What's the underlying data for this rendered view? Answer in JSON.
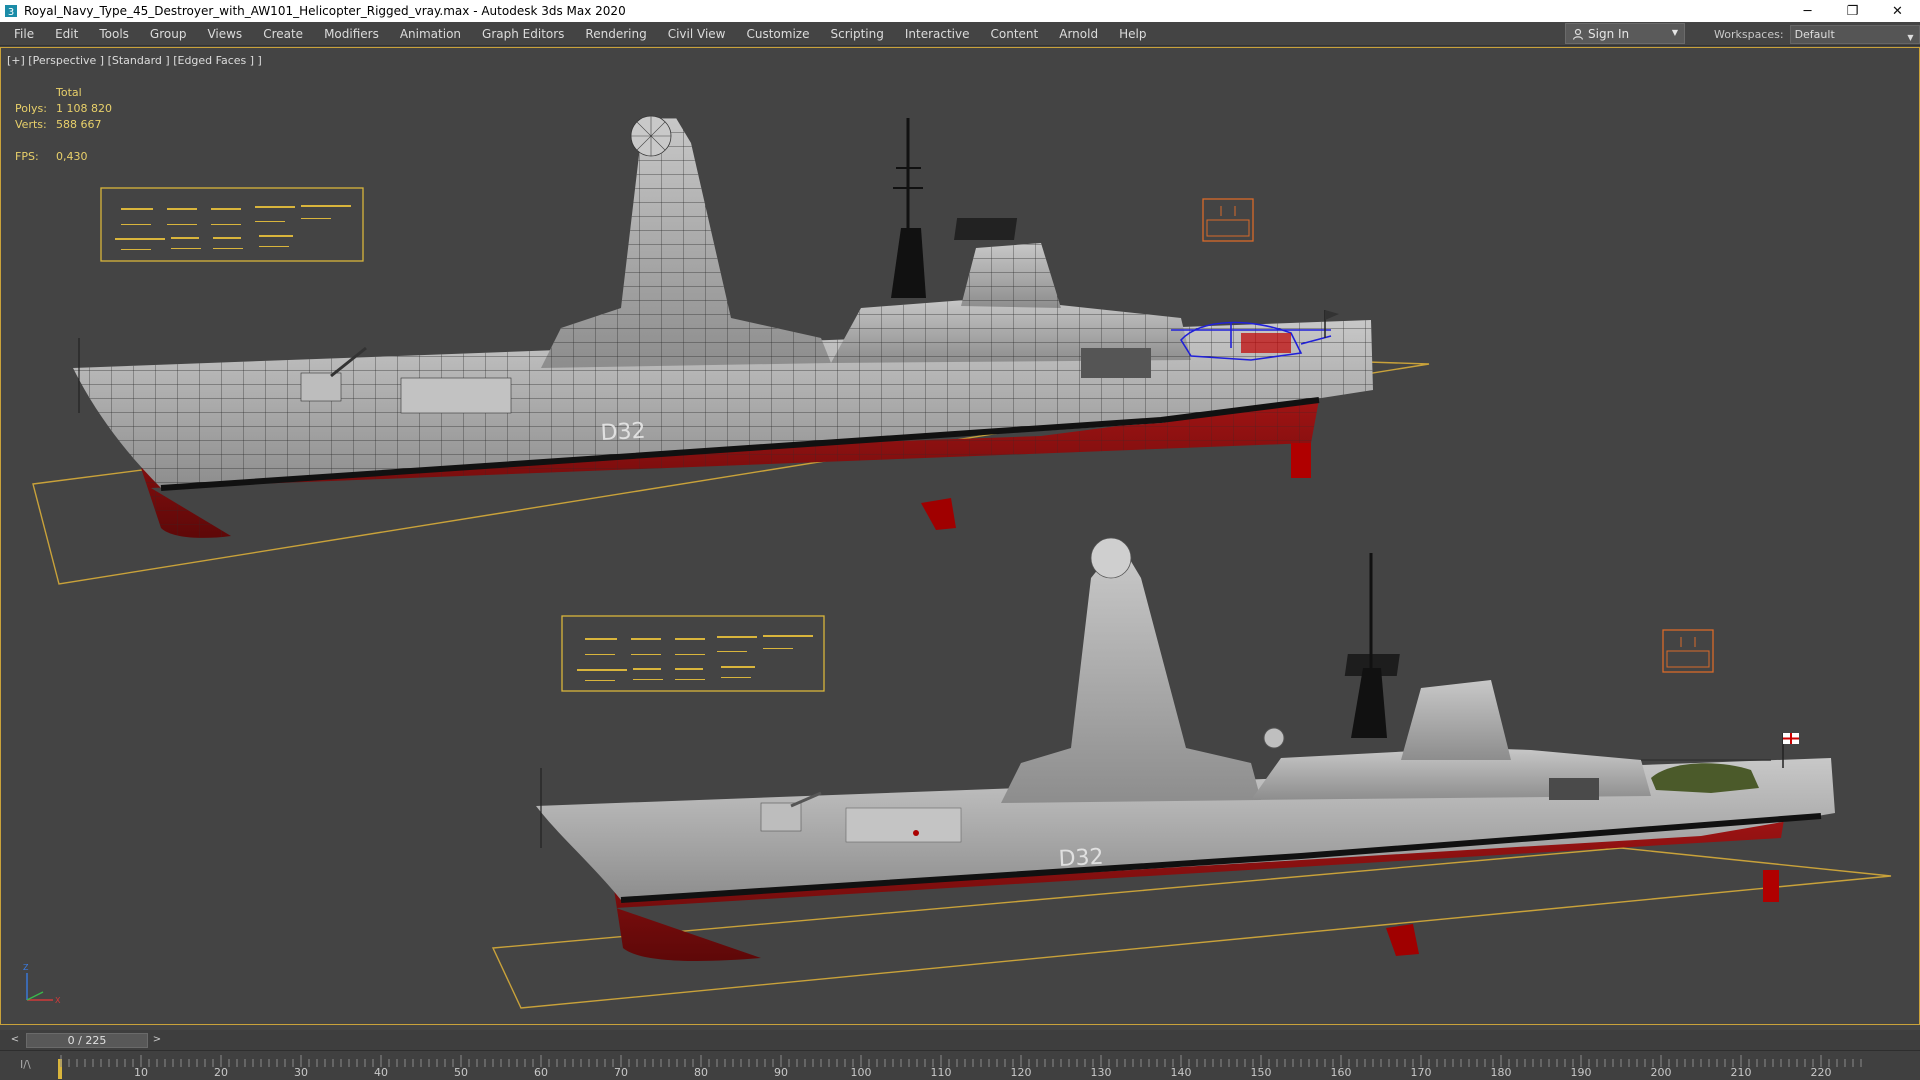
{
  "window": {
    "title": "Royal_Navy_Type_45_Destroyer_with_AW101_Helicopter_Rigged_vray.max - Autodesk 3ds Max 2020",
    "app_icon": "3ds-max-icon",
    "minimize": "─",
    "restore": "❐",
    "close": "✕"
  },
  "menu": {
    "items": [
      "File",
      "Edit",
      "Tools",
      "Group",
      "Views",
      "Create",
      "Modifiers",
      "Animation",
      "Graph Editors",
      "Rendering",
      "Civil View",
      "Customize",
      "Scripting",
      "Interactive",
      "Content",
      "Arnold",
      "Help"
    ],
    "sign_in": "Sign In",
    "workspaces_label": "Workspaces:",
    "workspaces_value": "Default"
  },
  "viewport": {
    "label": "[+] [Perspective ] [Standard ] [Edged Faces ]   ]",
    "stats": {
      "total_label": "Total",
      "polys_label": "Polys:",
      "polys_value": "1 108 820",
      "verts_label": "Verts:",
      "verts_value": "588 667",
      "fps_label": "FPS:",
      "fps_value": "0,430"
    },
    "hull_number_top": "D32",
    "hull_number_bottom": "D32",
    "axis_labels": [
      "Z",
      "X"
    ],
    "colors": {
      "selection": "#d9b53c",
      "hull_red": "#8a1010",
      "hull_grey": "#a8a8a8",
      "wire_helicopter": "#2020d8"
    }
  },
  "timeline": {
    "frame_display": "0 / 225",
    "prev": "<",
    "next": ">",
    "ticks": [
      10,
      20,
      30,
      40,
      50,
      60,
      70,
      80,
      90,
      100,
      110,
      120,
      130,
      140,
      150,
      160,
      170,
      180,
      190,
      200,
      210,
      220
    ],
    "key_icon": "filter-keys-icon"
  }
}
